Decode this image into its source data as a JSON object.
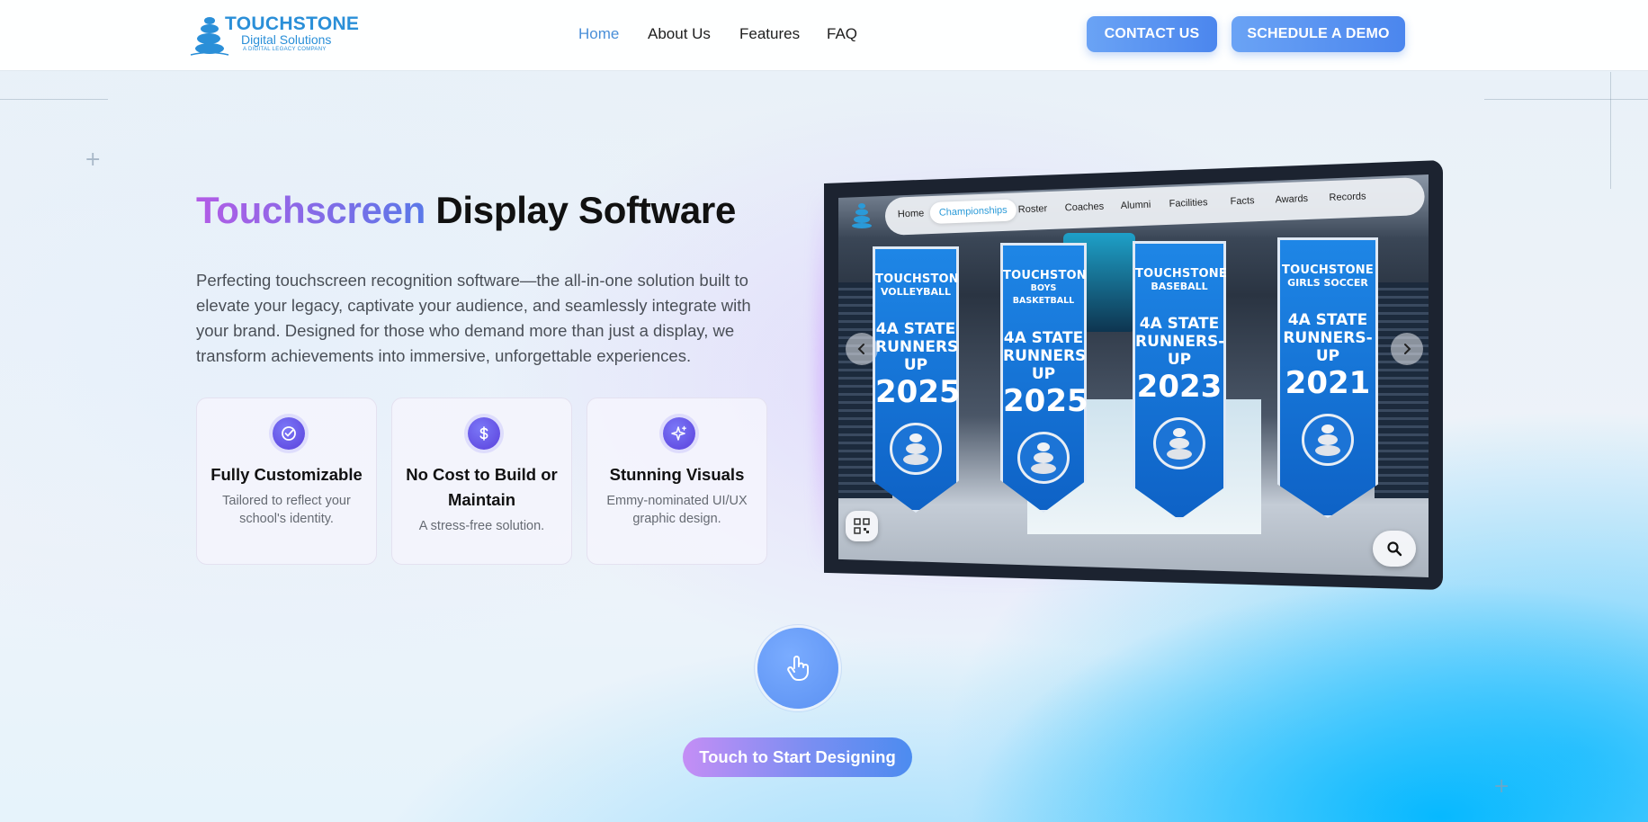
{
  "header": {
    "logo": {
      "title": "TOUCHSTONE",
      "subtitle": "Digital Solutions",
      "tagline": "A DIGITAL LEGACY COMPANY"
    },
    "nav": [
      {
        "label": "Home",
        "active": true
      },
      {
        "label": "About Us",
        "active": false
      },
      {
        "label": "Features",
        "active": false
      },
      {
        "label": "FAQ",
        "active": false
      }
    ],
    "contact_label": "CONTACT US",
    "demo_label": "SCHEDULE A DEMO"
  },
  "hero": {
    "title_highlight": "Touchscreen",
    "title_rest": "Display Software",
    "description": "Perfecting touchscreen recognition software—the all-in-one solution built to elevate your legacy, captivate your audience, and seamlessly integrate with your brand. Designed for those who demand more than just a display, we transform achievements into immersive, unforgettable experiences."
  },
  "features": [
    {
      "icon": "check-circle-icon",
      "title": "Fully Customizable",
      "text": "Tailored to reflect your school's identity."
    },
    {
      "icon": "dollar-icon",
      "title": "No Cost to Build or Maintain",
      "text": "A stress-free solution."
    },
    {
      "icon": "sparkle-icon",
      "title": "Stunning Visuals",
      "text": "Emmy-nominated UI/UX graphic design."
    }
  ],
  "display": {
    "nav": [
      "Home",
      "Championships",
      "Roster",
      "Coaches",
      "Alumni",
      "Facilities",
      "Facts",
      "Awards",
      "Records"
    ],
    "active_nav": "Championships",
    "banners": [
      {
        "school": "TOUCHSTONE",
        "sport": "VOLLEYBALL",
        "state": "4A STATE RUNNERS-UP",
        "year": "2025"
      },
      {
        "school": "TOUCHSTONE",
        "sport": "BOYS BASKETBALL",
        "state": "4A STATE RUNNERS-UP",
        "year": "2025"
      },
      {
        "school": "TOUCHSTONE",
        "sport": "BASEBALL",
        "state": "4A STATE RUNNERS-UP",
        "year": "2023"
      },
      {
        "school": "TOUCHSTONE",
        "sport": "GIRLS SOCCER",
        "state": "4A STATE RUNNERS-UP",
        "year": "2021"
      }
    ]
  },
  "cta": {
    "touch_icon": "hand-pointer-icon",
    "start_label": "Touch to Start Designing"
  },
  "colors": {
    "accent_blue": "#4b86ee",
    "nav_active": "#4a8fd8",
    "icon_purple": "#5a40dc",
    "banner_blue": "#1e86e6"
  }
}
